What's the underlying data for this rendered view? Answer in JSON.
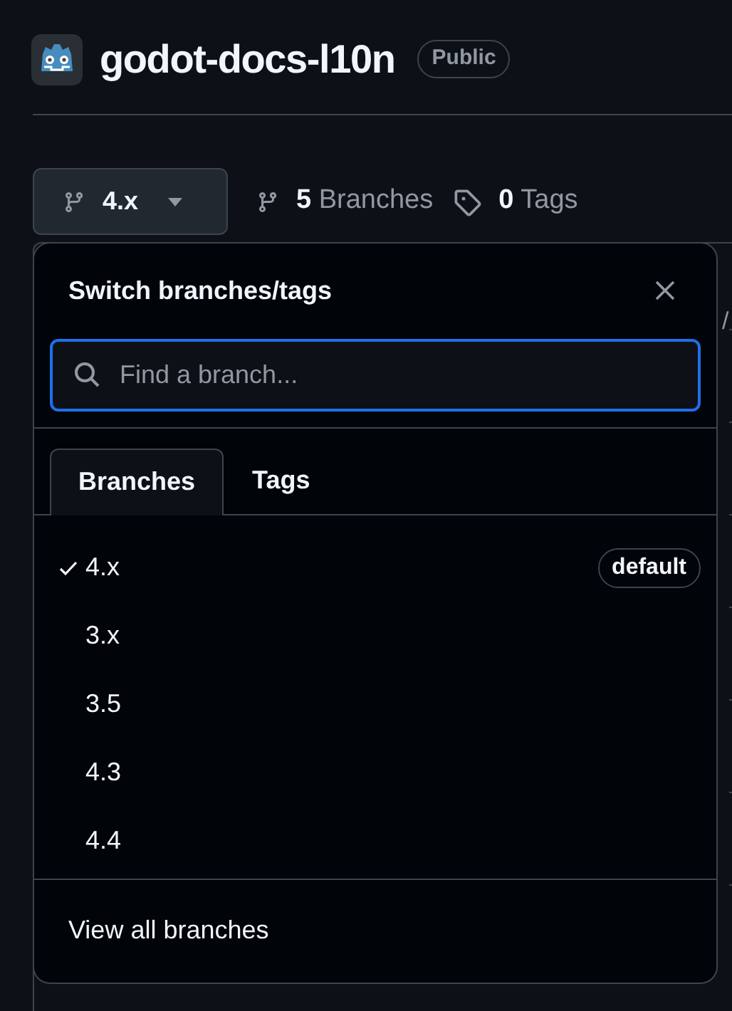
{
  "repo": {
    "name": "godot-docs-l10n",
    "visibility": "Public"
  },
  "branch_button": {
    "label": "4.x"
  },
  "stats": [
    {
      "kind": "branches",
      "count": "5",
      "label": "Branches"
    },
    {
      "kind": "tags",
      "count": "0",
      "label": "Tags"
    }
  ],
  "background_table": {
    "fragment": "/"
  },
  "popup": {
    "title": "Switch branches/tags",
    "search": {
      "placeholder": "Find a branch..."
    },
    "tabs": [
      {
        "label": "Branches",
        "selected": true
      },
      {
        "label": "Tags",
        "selected": false
      }
    ],
    "items": [
      {
        "label": "4.x",
        "selected": true,
        "badge": "default"
      },
      {
        "label": "3.x",
        "selected": false
      },
      {
        "label": "3.5",
        "selected": false
      },
      {
        "label": "4.3",
        "selected": false
      },
      {
        "label": "4.4",
        "selected": false
      }
    ],
    "footer_link": "View all branches"
  }
}
